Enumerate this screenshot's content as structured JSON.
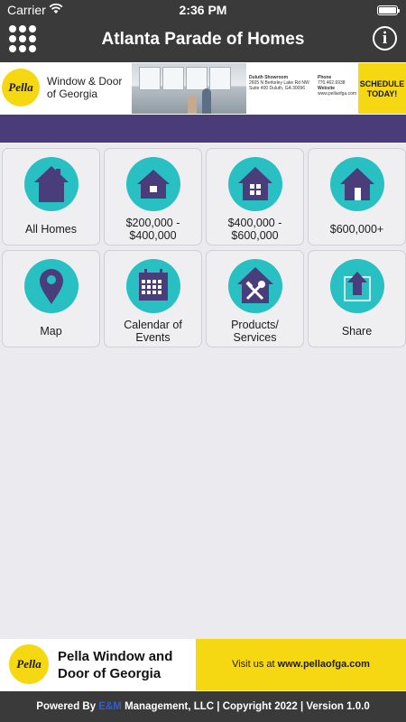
{
  "status": {
    "carrier": "Carrier",
    "time": "2:36 PM"
  },
  "nav": {
    "title": "Atlanta Parade of Homes",
    "info_glyph": "i"
  },
  "ad_top": {
    "logo": "Pella",
    "brand": "Window & Door of Georgia",
    "showroom_title": "Duluth Showroom",
    "address": "2605 N Berkeley Lake Rd NW Suite 400 Duluth, GA 30096",
    "phone_label": "Phone",
    "phone": "770.462.6938",
    "website_label": "Website",
    "website": "www.pellaofga.com",
    "cta": "SCHEDULE TODAY!"
  },
  "tiles": [
    {
      "label": "All Homes",
      "icon": "house-outline-icon"
    },
    {
      "label": "$200,000 - $400,000",
      "icon": "house-small-icon"
    },
    {
      "label": "$400,000 - $600,000",
      "icon": "house-windows-icon"
    },
    {
      "label": "$600,000+",
      "icon": "house-door-icon"
    },
    {
      "label": "Map",
      "icon": "map-pin-icon"
    },
    {
      "label": "Calendar of Events",
      "icon": "calendar-icon"
    },
    {
      "label": "Products/ Services",
      "icon": "tools-house-icon"
    },
    {
      "label": "Share",
      "icon": "share-icon"
    }
  ],
  "ad_bottom": {
    "logo": "Pella",
    "brand": "Pella Window and Door of Georgia",
    "visit_prefix": "Visit us at ",
    "visit_url": "www.pellaofga.com"
  },
  "footer": {
    "prefix": "Powered By ",
    "company_mark": "E&M",
    "suffix": " Management, LLC | Copyright 2022 | Version 1.0.0"
  },
  "colors": {
    "bar": "#3a3a3a",
    "purple": "#493c78",
    "teal": "#28c0c2",
    "icon": "#4a3d7c",
    "yellow": "#f5d812"
  }
}
